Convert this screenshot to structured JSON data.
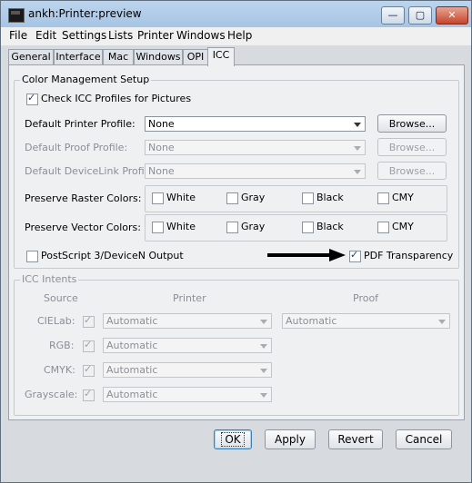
{
  "window": {
    "title": "ankh:Printer:preview",
    "minimize_glyph": "—",
    "maximize_glyph": "▢",
    "close_glyph": "✕"
  },
  "menu": [
    "File",
    "Edit",
    "Settings",
    "Lists",
    "Printer",
    "Windows",
    "Help"
  ],
  "tabs": [
    "General",
    "Interface",
    "Mac",
    "Windows",
    "OPI",
    "ICC"
  ],
  "active_tab": "ICC",
  "color_management": {
    "title": "Color Management Setup",
    "check_icc": {
      "label": "Check ICC Profiles for Pictures",
      "checked": true
    },
    "default_printer_profile": {
      "label": "Default Printer Profile:",
      "value": "None",
      "browse": "Browse...",
      "enabled": true
    },
    "default_proof_profile": {
      "label": "Default Proof Profile:",
      "value": "None",
      "browse": "Browse...",
      "enabled": false
    },
    "default_devicelink_profile": {
      "label": "Default DeviceLink Profile:",
      "value": "None",
      "browse": "Browse...",
      "enabled": false
    },
    "preserve_raster": {
      "label": "Preserve Raster Colors:",
      "options": [
        "White",
        "Gray",
        "Black",
        "CMY"
      ]
    },
    "preserve_vector": {
      "label": "Preserve Vector Colors:",
      "options": [
        "White",
        "Gray",
        "Black",
        "CMY"
      ]
    },
    "postscript": {
      "label": "PostScript 3/DeviceN Output",
      "checked": false
    },
    "pdf_transparency": {
      "label": "PDF Transparency",
      "checked": true
    }
  },
  "icc_intents": {
    "title": "ICC Intents",
    "headers": {
      "source": "Source",
      "printer": "Printer",
      "proof": "Proof"
    },
    "rows": [
      {
        "source": "CIELab:",
        "printer": "Automatic",
        "proof": "Automatic"
      },
      {
        "source": "RGB:",
        "printer": "Automatic"
      },
      {
        "source": "CMYK:",
        "printer": "Automatic"
      },
      {
        "source": "Grayscale:",
        "printer": "Automatic"
      }
    ]
  },
  "buttons": {
    "ok": "OK",
    "apply": "Apply",
    "revert": "Revert",
    "cancel": "Cancel"
  }
}
